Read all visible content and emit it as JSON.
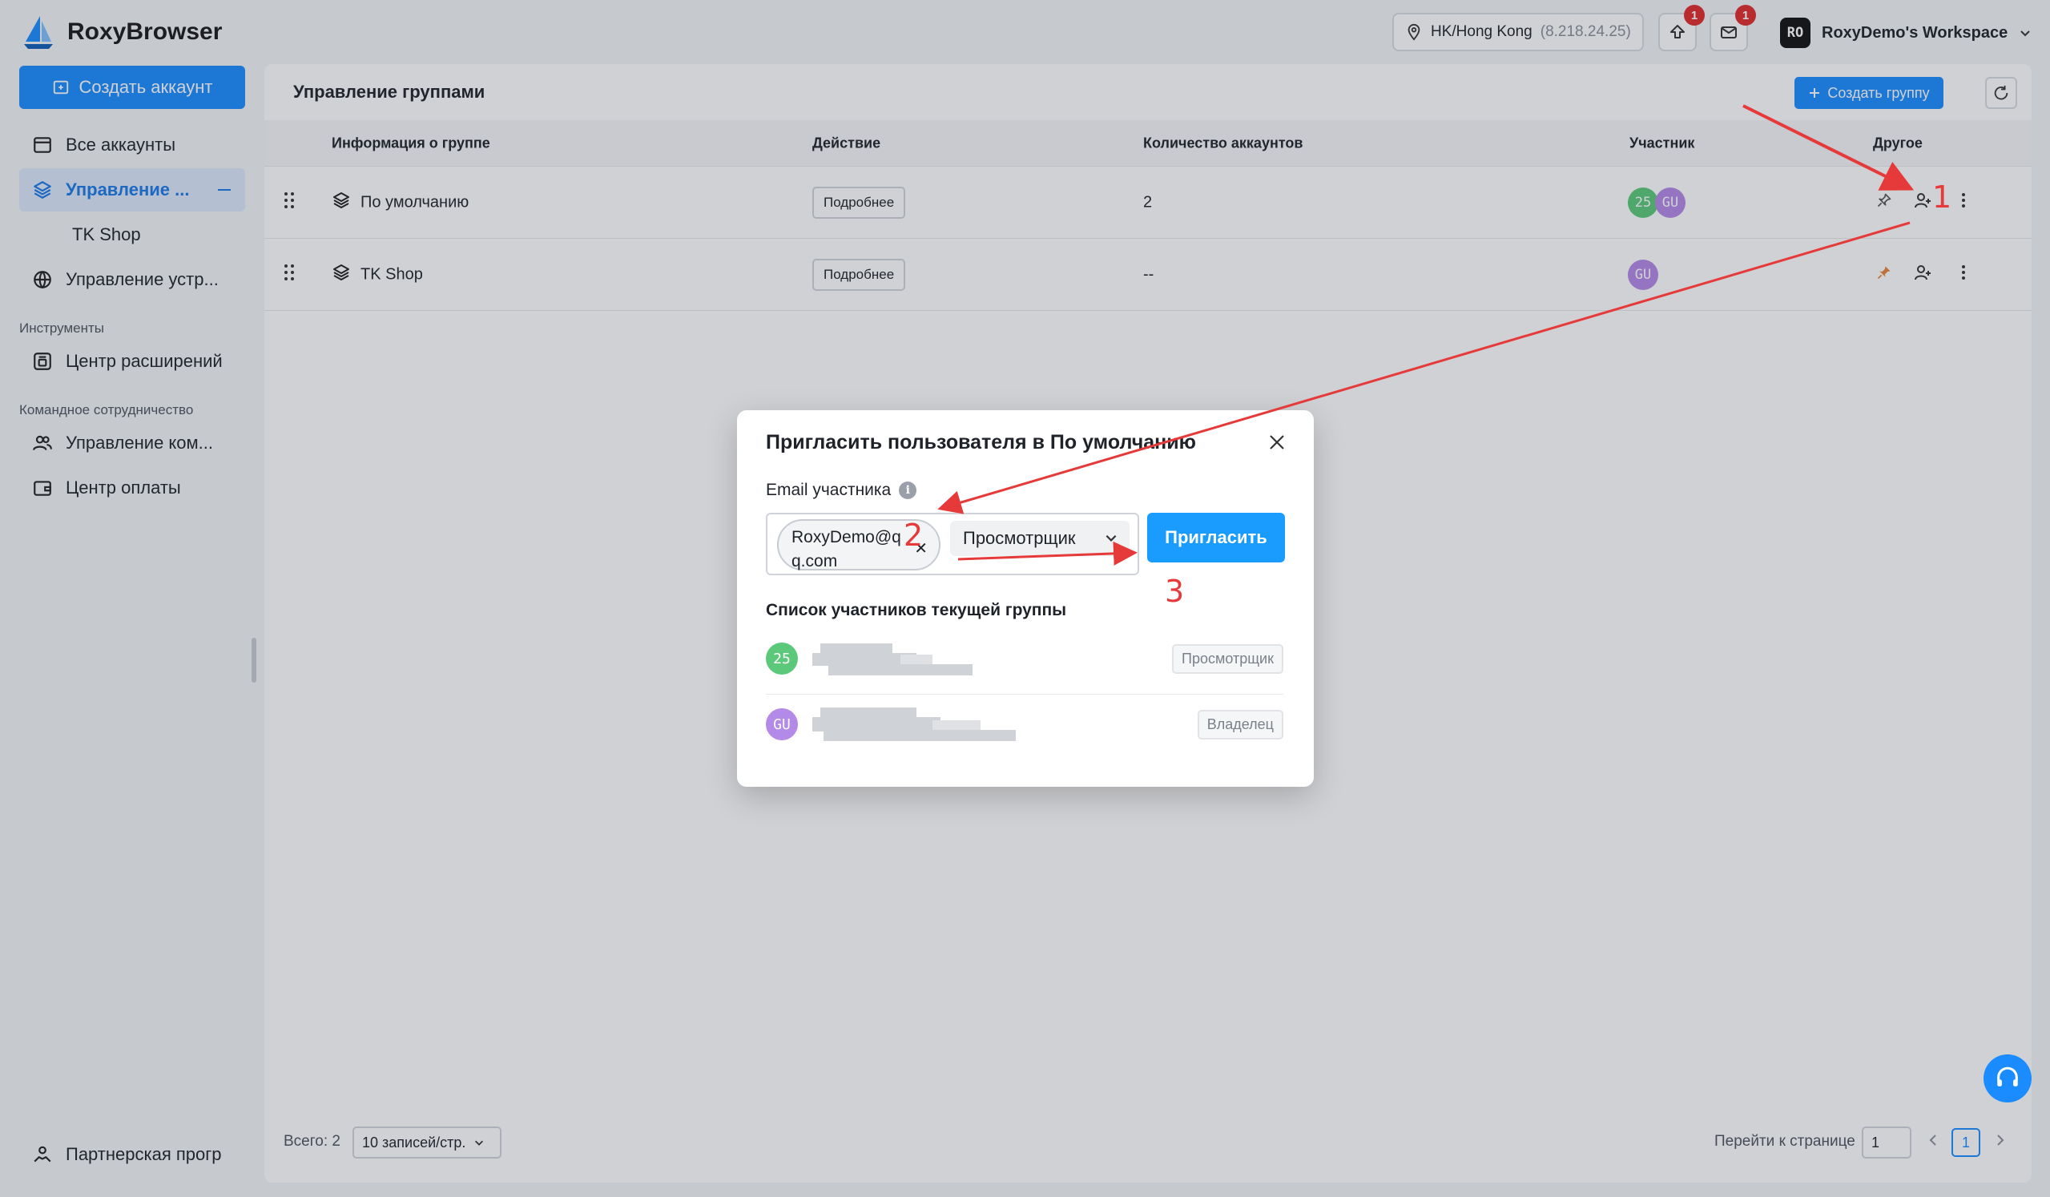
{
  "app": {
    "name": "RoxyBrowser"
  },
  "topbar": {
    "location": "HK/Hong Kong",
    "ip": "(8.218.24.25)",
    "upload_badge": "1",
    "mail_badge": "1",
    "workspace_avatar": "RO",
    "workspace_name": "RoxyDemo's Workspace"
  },
  "sidebar": {
    "create_button": "Создать аккаунт",
    "items": [
      {
        "label": "Все аккаунты",
        "icon": "browser-window-icon"
      },
      {
        "label": "Управление ...",
        "icon": "layers-icon"
      },
      {
        "label": "TK Shop"
      },
      {
        "label": "Управление устр...",
        "icon": "globe-icon"
      }
    ],
    "section_tools": "Инструменты",
    "tools": [
      {
        "label": "Центр расширений",
        "icon": "extension-icon"
      }
    ],
    "section_team": "Командное сотрудничество",
    "team": [
      {
        "label": "Управление ком...",
        "icon": "users-icon"
      },
      {
        "label": "Центр оплаты",
        "icon": "wallet-icon"
      }
    ],
    "partner": "Партнерская прогр"
  },
  "main": {
    "title": "Управление группами",
    "create_group": "Создать группу",
    "columns": [
      "Информация о группе",
      "Действие",
      "Количество аккаунтов",
      "Участник",
      "Другое"
    ],
    "rows": [
      {
        "name": "По умолчанию",
        "action": "Подробнее",
        "count": "2",
        "members": [
          "25",
          "GU"
        ]
      },
      {
        "name": "TK Shop",
        "action": "Подробнее",
        "count": "--",
        "members": [
          "GU"
        ]
      }
    ],
    "footer": {
      "total": "Всего: 2",
      "page_size": "10 записей/стр.",
      "goto": "Перейти к странице",
      "goto_value": "1",
      "current_page": "1"
    }
  },
  "modal": {
    "title": "Пригласить пользователя в По умолчанию",
    "email_label": "Email участника",
    "email_value": "RoxyDemo@qq.com",
    "role": "Просмотрщик",
    "invite": "Пригласить",
    "list_title": "Список участников текущей группы",
    "members": [
      {
        "avatar": "25",
        "role": "Просмотрщик",
        "color": "#5cc97a"
      },
      {
        "avatar": "GU",
        "role": "Владелец",
        "color": "#b48ae8"
      }
    ]
  },
  "annotations": [
    "1",
    "2",
    "3"
  ],
  "colors": {
    "primary": "#1a8cff",
    "active_bg": "#dce9fb",
    "annotation": "#e63a3a",
    "pin": "#e8833a"
  }
}
